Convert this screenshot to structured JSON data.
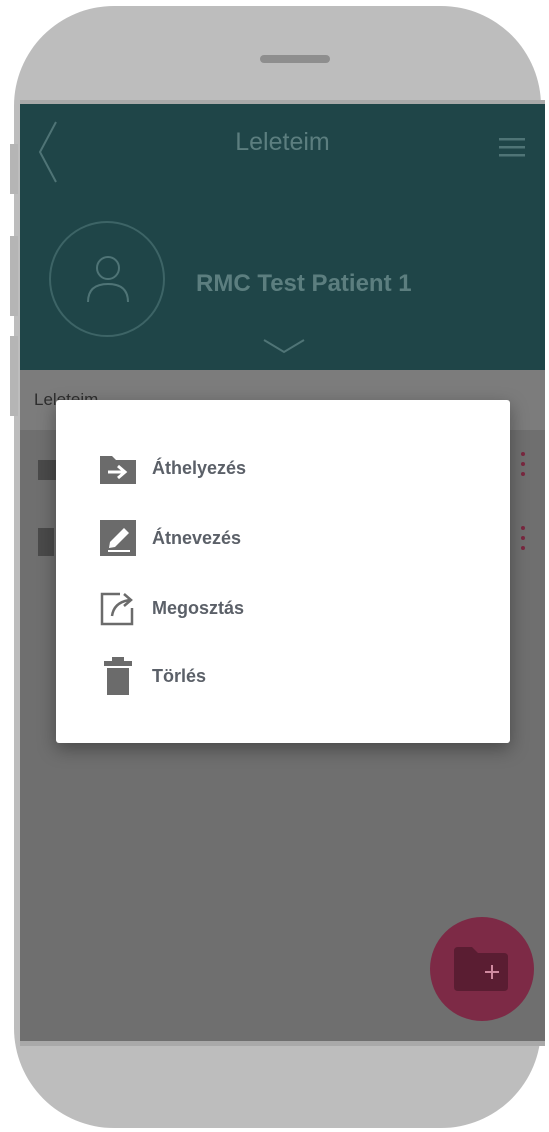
{
  "header": {
    "title": "Leleteim",
    "patient_name": "RMC Test Patient 1"
  },
  "subheader": {
    "label": "Leleteim"
  },
  "popup_menu": {
    "items": [
      {
        "label": "Áthelyezés",
        "icon": "folder-move-icon"
      },
      {
        "label": "Átnevezés",
        "icon": "edit-icon"
      },
      {
        "label": "Megosztás",
        "icon": "share-icon"
      },
      {
        "label": "Törlés",
        "icon": "trash-icon"
      }
    ]
  },
  "colors": {
    "header_bg": "#1f4548",
    "accent": "#7d2a46",
    "menu_text": "#5b6068"
  }
}
